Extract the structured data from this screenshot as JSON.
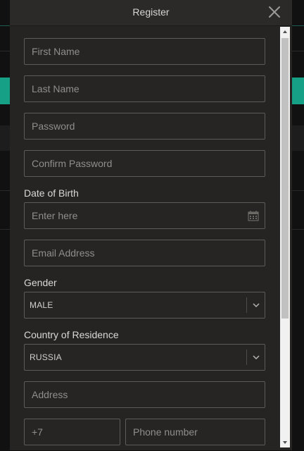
{
  "modal": {
    "title": "Register"
  },
  "form": {
    "first_name_placeholder": "First Name",
    "last_name_placeholder": "Last Name",
    "password_placeholder": "Password",
    "confirm_password_placeholder": "Confirm Password",
    "dob_label": "Date of Birth",
    "dob_placeholder": "Enter here",
    "email_placeholder": "Email Address",
    "gender_label": "Gender",
    "gender_value": "MALE",
    "country_label": "Country of Residence",
    "country_value": "RUSSIA",
    "address_placeholder": "Address",
    "phone_code_placeholder": "+7",
    "phone_number_placeholder": "Phone number"
  },
  "icons": {
    "close": "close-icon",
    "calendar": "calendar-icon",
    "chevron": "chevron-down-icon"
  },
  "colors": {
    "modal_bg": "#252422",
    "field_border": "#5c5b58",
    "accent_band": "#1aa88c"
  }
}
